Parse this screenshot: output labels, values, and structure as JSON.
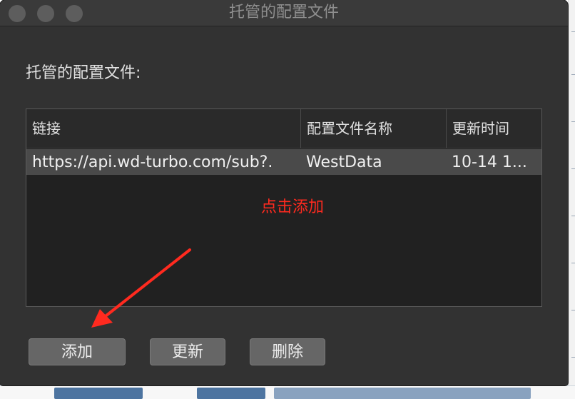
{
  "window": {
    "title": "托管的配置文件"
  },
  "section_label": "托管的配置文件:",
  "table": {
    "columns": [
      "链接",
      "配置文件名称",
      "更新时间"
    ],
    "rows": [
      {
        "link": "https://api.wd-turbo.com/sub?.",
        "name": "WestData",
        "updated": "10-14 1..."
      }
    ]
  },
  "annotation": {
    "text": "点击添加",
    "color": "#ff2a1f"
  },
  "buttons": {
    "add": "添加",
    "update": "更新",
    "delete": "删除"
  },
  "colors": {
    "window_bg": "#323232",
    "selected_row": "#4a4a4a",
    "annotation": "#ff2a1f"
  }
}
